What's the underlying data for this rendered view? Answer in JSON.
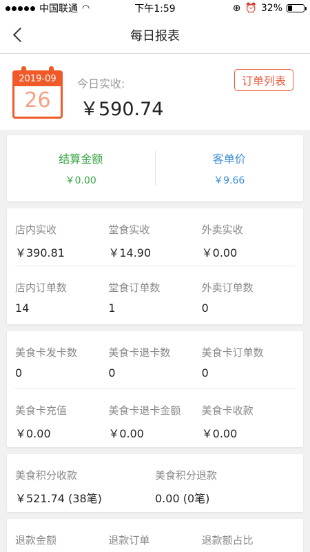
{
  "status": {
    "carrier": "中国联通",
    "time": "下午1:59",
    "battery": "32%",
    "battery_level": 0.32
  },
  "nav": {
    "title": "每日报表"
  },
  "today": {
    "date_month": "2019-09",
    "date_day": "26",
    "label": "今日实收:",
    "amount": "￥590.74",
    "order_list_button": "订单列表"
  },
  "summary": {
    "settle_label": "结算金额",
    "settle_value": "￥0.00",
    "avg_label": "客单价",
    "avg_value": "￥9.66"
  },
  "store": {
    "rows": [
      [
        {
          "k": "店内实收",
          "v": "￥390.81"
        },
        {
          "k": "堂食实收",
          "v": "￥14.90"
        },
        {
          "k": "外卖实收",
          "v": "￥0.00"
        }
      ],
      [
        {
          "k": "店内订单数",
          "v": "14"
        },
        {
          "k": "堂食订单数",
          "v": "1"
        },
        {
          "k": "外卖订单数",
          "v": "0"
        }
      ]
    ]
  },
  "card": {
    "rows": [
      [
        {
          "k": "美食卡发卡数",
          "v": "0"
        },
        {
          "k": "美食卡退卡数",
          "v": "0"
        },
        {
          "k": "美食卡订单数",
          "v": "0"
        }
      ],
      [
        {
          "k": "美食卡充值",
          "v": "￥0.00"
        },
        {
          "k": "美食卡退卡金额",
          "v": "￥0.00"
        },
        {
          "k": "美食卡收款",
          "v": "￥0.00"
        }
      ]
    ]
  },
  "points": {
    "collect_label": "美食积分收款",
    "collect_value": "￥521.74 (38笔)",
    "refund_label": "美食积分退款",
    "refund_value": "0.00 (0笔)"
  },
  "refund": {
    "amount_label": "退款金额",
    "order_label": "退款订单",
    "ratio_label": "退款额占比"
  },
  "colors": {
    "accent": "#f05a28",
    "green": "#35a33f",
    "blue": "#3a8cd6"
  }
}
